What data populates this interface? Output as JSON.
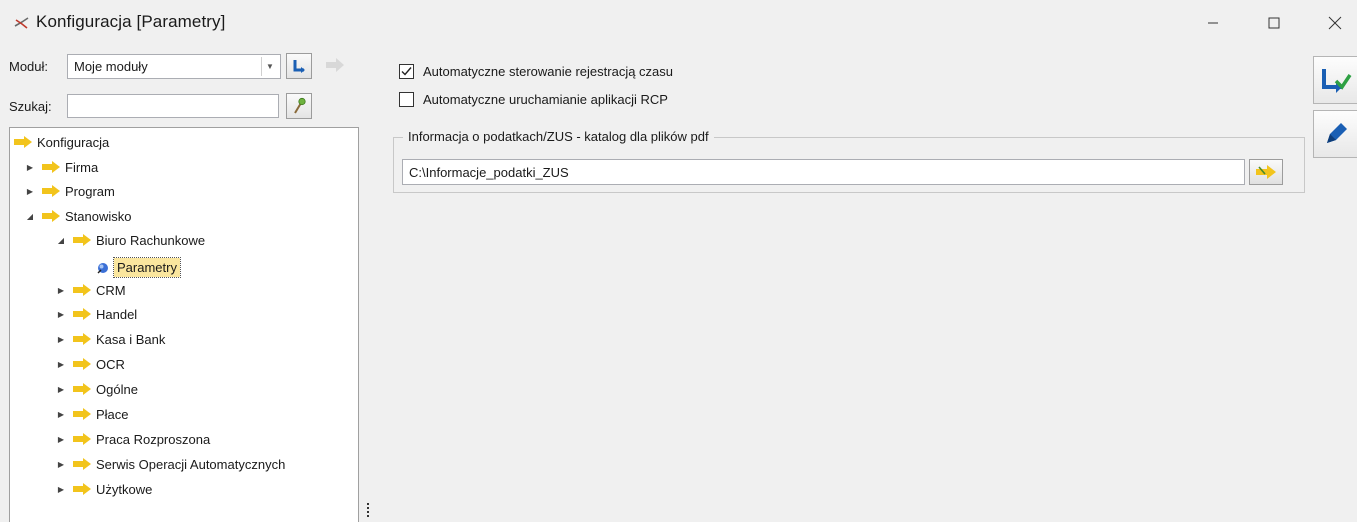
{
  "window": {
    "title": "Konfiguracja [Parametry]"
  },
  "left_panel": {
    "modul_label": "Moduł:",
    "modul_value": "Moje moduły",
    "search_label": "Szukaj:",
    "search_value": ""
  },
  "tree": {
    "root": "Konfiguracja",
    "items": [
      {
        "label": "Firma",
        "level": 1,
        "expanded": false
      },
      {
        "label": "Program",
        "level": 1,
        "expanded": false
      },
      {
        "label": "Stanowisko",
        "level": 1,
        "expanded": true
      },
      {
        "label": "Biuro Rachunkowe",
        "level": 2,
        "expanded": true
      },
      {
        "label": "Parametry",
        "level": 3,
        "selected": true
      },
      {
        "label": "CRM",
        "level": 2,
        "expanded": false
      },
      {
        "label": "Handel",
        "level": 2,
        "expanded": false
      },
      {
        "label": "Kasa i Bank",
        "level": 2,
        "expanded": false
      },
      {
        "label": "OCR",
        "level": 2,
        "expanded": false
      },
      {
        "label": "Ogólne",
        "level": 2,
        "expanded": false
      },
      {
        "label": "Płace",
        "level": 2,
        "expanded": false
      },
      {
        "label": "Praca Rozproszona",
        "level": 2,
        "expanded": false
      },
      {
        "label": "Serwis Operacji Automatycznych",
        "level": 2,
        "expanded": false
      },
      {
        "label": "Użytkowe",
        "level": 2,
        "expanded": false
      }
    ]
  },
  "settings": {
    "auto_time_label": "Automatyczne sterowanie rejestracją czasu",
    "auto_time_checked": true,
    "auto_rcp_label": "Automatyczne uruchamianie aplikacji RCP",
    "auto_rcp_checked": false,
    "group_title": "Informacja o podatkach/ZUS - katalog dla plików pdf",
    "path_value": "C:\\Informacje_podatki_ZUS"
  },
  "icons": {
    "app": "wrench-icon",
    "save": "save-icon",
    "edit": "edit-icon",
    "folder": "folder-icon",
    "refresh": "refresh-icon",
    "search": "search-icon",
    "browse": "browse-folder-icon"
  },
  "colors": {
    "folder": "#f2c41c",
    "selection": "#fae69e",
    "accent_blue": "#1a5fb4",
    "save_green": "#2ea043"
  }
}
